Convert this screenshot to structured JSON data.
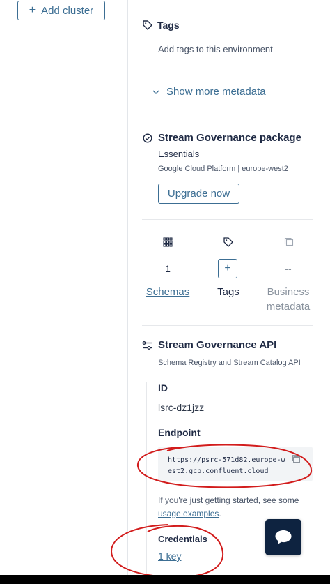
{
  "sidebar": {
    "add_cluster_label": "Add cluster"
  },
  "tags": {
    "label": "Tags",
    "placeholder": "Add tags to this environment"
  },
  "metadata": {
    "show_more_label": "Show more metadata"
  },
  "stream_governance": {
    "title": "Stream Governance package",
    "plan": "Essentials",
    "region": "Google Cloud Platform | europe-west2",
    "upgrade_label": "Upgrade now"
  },
  "stats": [
    {
      "icon": "grid-icon",
      "value": "1",
      "label": "Schemas",
      "link": true
    },
    {
      "icon": "tag-icon",
      "value": "+",
      "label": "Tags",
      "link": false
    },
    {
      "icon": "copy-stack-icon",
      "value": "--",
      "label": "Business metadata",
      "link": false
    }
  ],
  "api": {
    "title": "Stream Governance API",
    "subtitle": "Schema Registry and Stream Catalog API",
    "id_label": "ID",
    "id_value": "lsrc-dz1jzz",
    "endpoint_label": "Endpoint",
    "endpoint_value": "https://psrc-571d82.europe-west2.gcp.confluent.cloud",
    "help_prefix": "If you're just getting started, see some ",
    "help_link": "usage examples",
    "help_suffix": ".",
    "credentials_label": "Credentials",
    "credentials_value": "1 key"
  },
  "colors": {
    "accent": "#3c6e93",
    "text": "#1f2a44",
    "annotation": "#d21c1c",
    "chat": "#0e2340"
  }
}
